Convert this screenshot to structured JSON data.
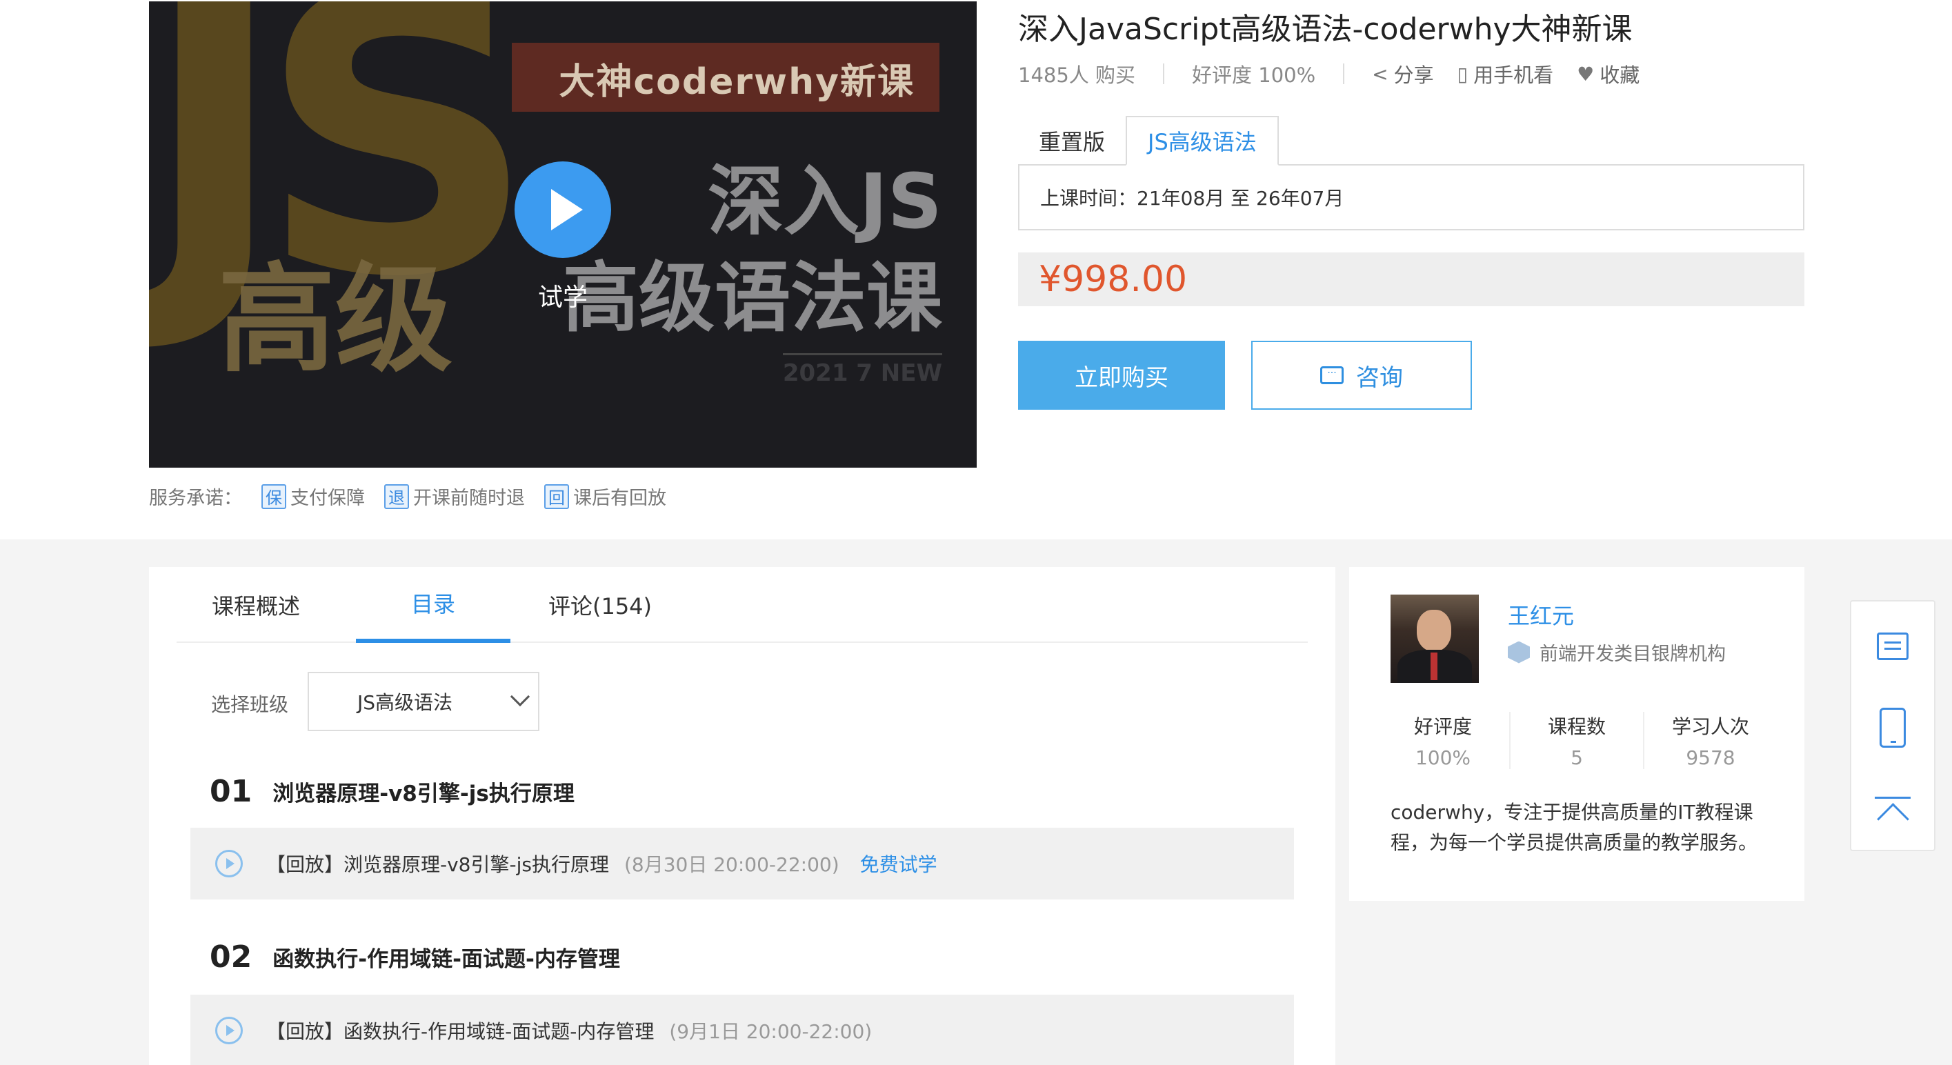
{
  "cover": {
    "banner_text": "大神coderwhy新课",
    "big_letters": "JS",
    "big_chars": "高级",
    "title_line1": "深入JS",
    "title_line2": "高级语法课",
    "new_mark": "2021 7 NEW",
    "trial_label": "试学"
  },
  "service": {
    "label": "服务承诺：",
    "items": [
      {
        "icon": "保",
        "label": "支付保障"
      },
      {
        "icon": "退",
        "label": "开课前随时退"
      },
      {
        "icon": "回",
        "label": "课后有回放"
      }
    ]
  },
  "course": {
    "title": "深入JavaScript高级语法-coderwhy大神新课",
    "buyers": "1485人 购买",
    "rating": "好评度 100%",
    "share": "分享",
    "mobile": "用手机看",
    "favorite": "收藏",
    "versions": [
      "重置版",
      "JS高级语法"
    ],
    "schedule": "上课时间：21年08月 至 26年07月",
    "price": "¥998.00",
    "buy_label": "立即购买",
    "consult_label": "咨询"
  },
  "tabs": [
    "课程概述",
    "目录",
    "评论(154)"
  ],
  "class_select": {
    "label": "选择班级",
    "value": "JS高级语法"
  },
  "chapters": [
    {
      "num": "01",
      "title": "浏览器原理-v8引擎-js执行原理",
      "lesson": "【回放】浏览器原理-v8引擎-js执行原理",
      "time": "(8月30日 20:00-22:00)",
      "free": "免费试学"
    },
    {
      "num": "02",
      "title": "函数执行-作用域链-面试题-内存管理",
      "lesson": "【回放】函数执行-作用域链-面试题-内存管理",
      "time": "(9月1日 20:00-22:00)"
    }
  ],
  "teacher": {
    "name": "王红元",
    "badge": "前端开发类目银牌机构",
    "stats": [
      {
        "label": "好评度",
        "value": "100%"
      },
      {
        "label": "课程数",
        "value": "5"
      },
      {
        "label": "学习人次",
        "value": "9578"
      }
    ],
    "desc": "coderwhy，专注于提供高质量的IT教程课程，为每一个学员提供高质量的教学服务。"
  },
  "colors": {
    "accent": "#2d8fe6",
    "price": "#e0562d",
    "buy": "#4aabea"
  }
}
